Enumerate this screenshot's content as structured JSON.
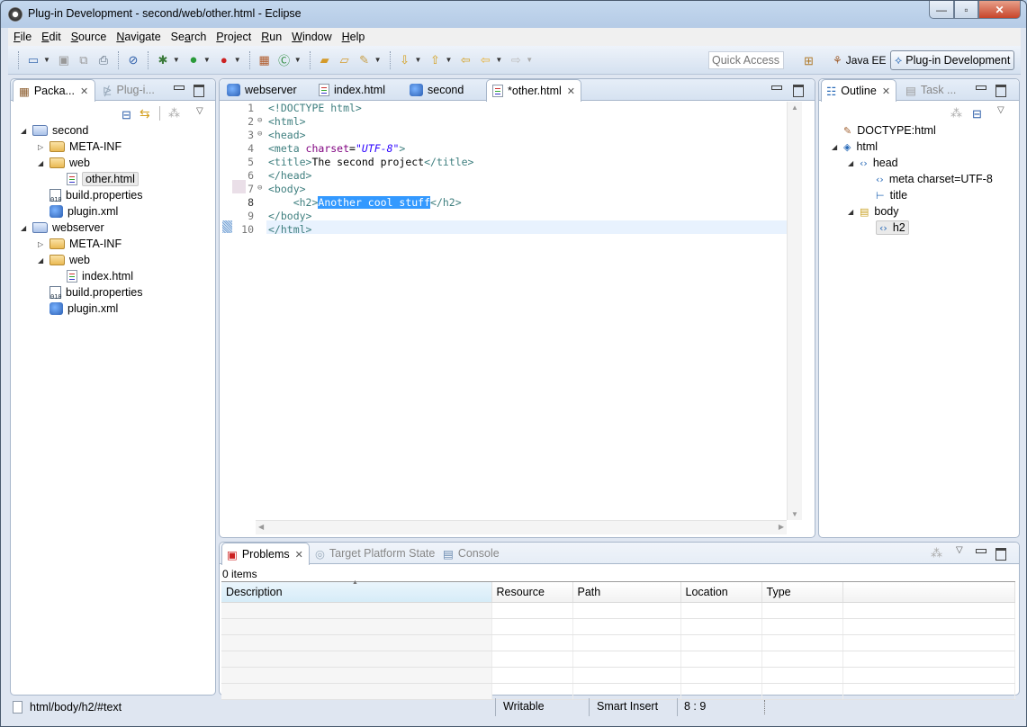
{
  "window": {
    "title": "Plug-in Development - second/web/other.html - Eclipse",
    "controls": {
      "minimize": "—",
      "maximize": "▫",
      "close": "✕"
    }
  },
  "menu": [
    {
      "label": "File",
      "mnemonic": "F"
    },
    {
      "label": "Edit",
      "mnemonic": "E"
    },
    {
      "label": "Source",
      "mnemonic": "S"
    },
    {
      "label": "Navigate",
      "mnemonic": "N"
    },
    {
      "label": "Search",
      "mnemonic": "a"
    },
    {
      "label": "Project",
      "mnemonic": "P"
    },
    {
      "label": "Run",
      "mnemonic": "R"
    },
    {
      "label": "Window",
      "mnemonic": "W"
    },
    {
      "label": "Help",
      "mnemonic": "H"
    }
  ],
  "toolbar": {
    "quick_access_placeholder": "Quick Access",
    "perspectives": {
      "java_ee": "Java EE",
      "plugin_dev": "Plug-in Development"
    }
  },
  "left_panel": {
    "tabs": [
      {
        "label": "Packa...",
        "active": true
      },
      {
        "label": "Plug-i...",
        "active": false
      }
    ],
    "tree": [
      {
        "label": "second",
        "type": "project",
        "depth": 0,
        "expanded": true
      },
      {
        "label": "META-INF",
        "type": "folder",
        "depth": 1,
        "expanded": false
      },
      {
        "label": "web",
        "type": "folder",
        "depth": 1,
        "expanded": true
      },
      {
        "label": "other.html",
        "type": "html",
        "depth": 2,
        "selected": true
      },
      {
        "label": "build.properties",
        "type": "properties",
        "depth": 1
      },
      {
        "label": "plugin.xml",
        "type": "plugin",
        "depth": 1
      },
      {
        "label": "webserver",
        "type": "project",
        "depth": 0,
        "expanded": true
      },
      {
        "label": "META-INF",
        "type": "folder",
        "depth": 1,
        "expanded": false
      },
      {
        "label": "web",
        "type": "folder",
        "depth": 1,
        "expanded": true
      },
      {
        "label": "index.html",
        "type": "html",
        "depth": 2
      },
      {
        "label": "build.properties",
        "type": "properties",
        "depth": 1
      },
      {
        "label": "plugin.xml",
        "type": "plugin",
        "depth": 1
      }
    ]
  },
  "editor": {
    "tabs": [
      {
        "label": "webserver",
        "icon": "plugin-icon"
      },
      {
        "label": "index.html",
        "icon": "html-file-icon"
      },
      {
        "label": "second",
        "icon": "plugin-icon"
      },
      {
        "label": "*other.html",
        "icon": "html-file-icon",
        "active": true
      }
    ],
    "lines": [
      {
        "n": "1",
        "fold": ""
      },
      {
        "n": "2",
        "fold": "⊖"
      },
      {
        "n": "3",
        "fold": "⊖"
      },
      {
        "n": "4",
        "fold": ""
      },
      {
        "n": "5",
        "fold": ""
      },
      {
        "n": "6",
        "fold": ""
      },
      {
        "n": "7",
        "fold": "⊖"
      },
      {
        "n": "8",
        "fold": ""
      },
      {
        "n": "9",
        "fold": ""
      },
      {
        "n": "10",
        "fold": ""
      }
    ],
    "code": {
      "l1": "<!DOCTYPE html>",
      "l2": "<html>",
      "l3": "<head>",
      "l4_tag": "<meta ",
      "l4_attr": "charset",
      "l4_eq": "=",
      "l4_val": "\"UTF-8\"",
      "l4_end": ">",
      "l5_open": "<title>",
      "l5_text": "The second project",
      "l5_close": "</title>",
      "l6": "</head>",
      "l7": "<body>",
      "l8_indent": "    ",
      "l8_open": "<h2>",
      "l8_text": "Another cool stuff",
      "l8_close": "</h2>",
      "l9": "</body>",
      "l10": "</html>"
    },
    "current_line": 8
  },
  "outline": {
    "tabs": [
      {
        "label": "Outline",
        "active": true
      },
      {
        "label": "Task ...",
        "active": false
      }
    ],
    "items": [
      {
        "label": "DOCTYPE:html",
        "depth": 0
      },
      {
        "label": "html",
        "depth": 0,
        "expanded": true
      },
      {
        "label": "head",
        "depth": 1,
        "expanded": true
      },
      {
        "label": "meta charset=UTF-8",
        "depth": 2
      },
      {
        "label": "title",
        "depth": 2
      },
      {
        "label": "body",
        "depth": 1,
        "expanded": true
      },
      {
        "label": "h2",
        "depth": 2,
        "selected": true
      }
    ]
  },
  "bottom_panel": {
    "tabs": [
      {
        "label": "Problems",
        "active": true
      },
      {
        "label": "Target Platform State",
        "active": false
      },
      {
        "label": "Console",
        "active": false
      }
    ],
    "summary": "0 items",
    "columns": [
      "Description",
      "Resource",
      "Path",
      "Location",
      "Type"
    ],
    "sort_indicator": "▲",
    "rows": []
  },
  "status": {
    "path": "html/body/h2/#text",
    "writable": "Writable",
    "insert_mode": "Smart Insert",
    "cursor": "8 : 9"
  }
}
